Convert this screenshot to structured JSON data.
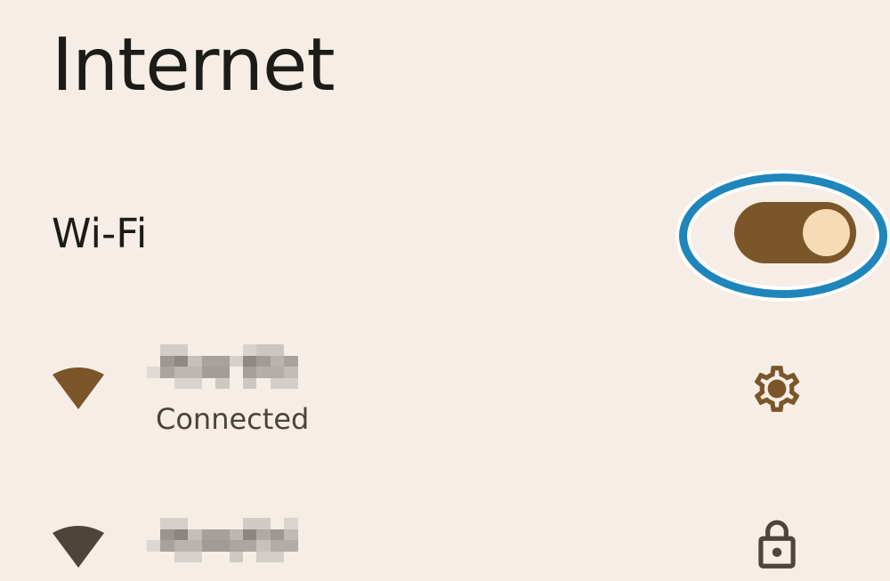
{
  "page": {
    "title": "Internet"
  },
  "wifi": {
    "label": "Wi-Fi",
    "enabled": true
  },
  "networks": [
    {
      "ssid_visible": false,
      "status": "Connected",
      "signal_icon": "wifi-signal-icon",
      "action_icon": "gear-icon"
    },
    {
      "ssid_visible": false,
      "status": "",
      "signal_icon": "wifi-signal-icon",
      "action_icon": "lock-icon"
    }
  ],
  "colors": {
    "background": "#f5ede6",
    "accent": "#7a5629",
    "toggle_thumb": "#f6dbb4",
    "highlight": "#1f86bb",
    "icon_dark": "#4e443a"
  }
}
